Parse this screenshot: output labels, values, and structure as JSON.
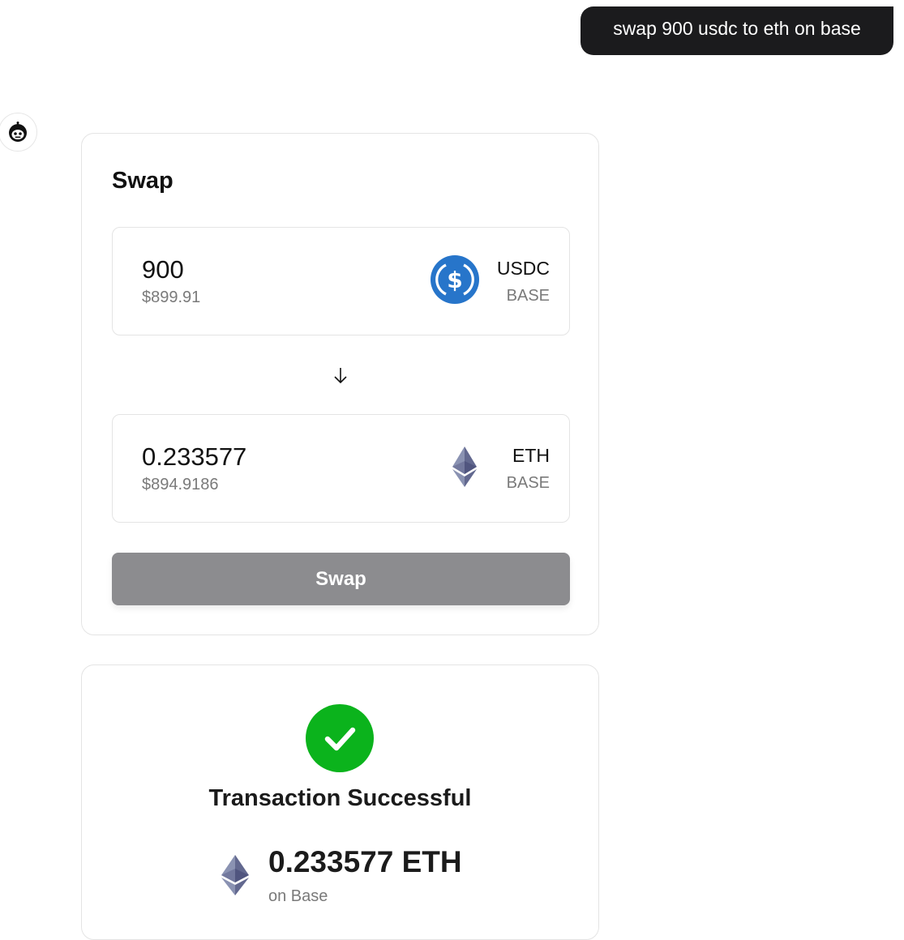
{
  "user_message": "swap 900 usdc to eth on base",
  "assistant": {
    "avatar_icon": "robot-face-icon"
  },
  "swap_card": {
    "title": "Swap",
    "from": {
      "amount": "900",
      "usd_value": "$899.91",
      "symbol": "USDC",
      "chain": "BASE",
      "icon": "usdc-icon",
      "icon_color": "#2775ca"
    },
    "direction_icon": "arrow-down-icon",
    "to": {
      "amount": "0.233577",
      "usd_value": "$894.9186",
      "symbol": "ETH",
      "chain": "BASE",
      "icon": "ethereum-icon",
      "icon_color": "#627eea"
    },
    "button_label": "Swap",
    "button_color": "#8c8c8f"
  },
  "result_card": {
    "status_icon": "checkmark-icon",
    "status_color": "#0bb31c",
    "title": "Transaction Successful",
    "amount": "0.233577 ETH",
    "network": "on Base",
    "token_icon": "ethereum-icon"
  }
}
